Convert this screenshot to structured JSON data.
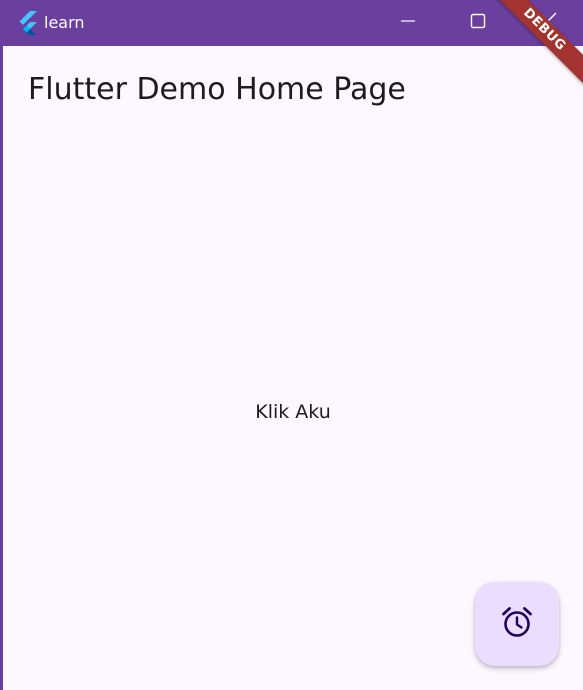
{
  "window": {
    "title": "learn",
    "app_icon": "flutter-logo-icon",
    "controls": {
      "minimize_icon": "minimize-icon",
      "maximize_icon": "maximize-icon",
      "close_icon": "close-icon"
    },
    "titlebar_color": "#6a3f9e"
  },
  "debug_banner": {
    "label": "DEBUG",
    "color": "#a2332f"
  },
  "app_bar": {
    "title": "Flutter Demo Home Page"
  },
  "body": {
    "center_text": "Klik Aku",
    "background_color": "#fdf7ff"
  },
  "fab": {
    "icon": "alarm-icon",
    "background_color": "#eaddff"
  }
}
